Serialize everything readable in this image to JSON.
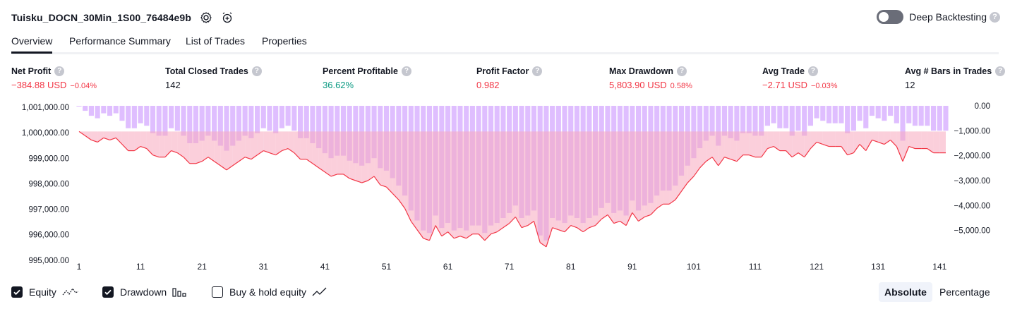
{
  "header": {
    "strategy_name": "Tuisku_DOCN_30Min_1S00_76484e9b",
    "deep_backtesting_label": "Deep Backtesting",
    "help_glyph": "?"
  },
  "tabs": [
    "Overview",
    "Performance Summary",
    "List of Trades",
    "Properties"
  ],
  "metrics": [
    {
      "label": "Net Profit",
      "value": "−384.88 USD",
      "pct": "−0.04%",
      "color": "red"
    },
    {
      "label": "Total Closed Trades",
      "value": "142",
      "pct": "",
      "color": "dark"
    },
    {
      "label": "Percent Profitable",
      "value": "36.62%",
      "pct": "",
      "color": "green"
    },
    {
      "label": "Profit Factor",
      "value": "0.982",
      "pct": "",
      "color": "red"
    },
    {
      "label": "Max Drawdown",
      "value": "5,803.90 USD",
      "pct": "0.58%",
      "color": "red"
    },
    {
      "label": "Avg Trade",
      "value": "−2.71 USD",
      "pct": "−0.03%",
      "color": "red"
    },
    {
      "label": "Avg # Bars in Trades",
      "value": "12",
      "pct": "",
      "color": "dark"
    }
  ],
  "legend": {
    "equity": "Equity",
    "drawdown": "Drawdown",
    "buy_hold": "Buy & hold equity",
    "equity_checked": true,
    "drawdown_checked": true,
    "buy_hold_checked": false
  },
  "view_modes": {
    "absolute": "Absolute",
    "percentage": "Percentage",
    "selected": "Absolute"
  },
  "colors": {
    "equity_loss": "#f23645",
    "equity_gain": "#22ab94",
    "drawdown_bar": "#d9b3ff",
    "loss_fill": "#f7a8be",
    "gain_fill": "#c9ede3",
    "text": "#131722"
  },
  "chart_data": {
    "type": "line",
    "x": [
      1,
      2,
      3,
      4,
      5,
      6,
      7,
      8,
      9,
      10,
      11,
      12,
      13,
      14,
      15,
      16,
      17,
      18,
      19,
      20,
      21,
      22,
      23,
      24,
      25,
      26,
      27,
      28,
      29,
      30,
      31,
      32,
      33,
      34,
      35,
      36,
      37,
      38,
      39,
      40,
      41,
      42,
      43,
      44,
      45,
      46,
      47,
      48,
      49,
      50,
      51,
      52,
      53,
      54,
      55,
      56,
      57,
      58,
      59,
      60,
      61,
      62,
      63,
      64,
      65,
      66,
      67,
      68,
      69,
      70,
      71,
      72,
      73,
      74,
      75,
      76,
      77,
      78,
      79,
      80,
      81,
      82,
      83,
      84,
      85,
      86,
      87,
      88,
      89,
      90,
      91,
      92,
      93,
      94,
      95,
      96,
      97,
      98,
      99,
      100,
      101,
      102,
      103,
      104,
      105,
      106,
      107,
      108,
      109,
      110,
      111,
      112,
      113,
      114,
      115,
      116,
      117,
      118,
      119,
      120,
      121,
      122,
      123,
      124,
      125,
      126,
      127,
      128,
      129,
      130,
      131,
      132,
      133,
      134,
      135,
      136,
      137,
      138,
      139,
      140,
      141,
      142
    ],
    "x_ticks": [
      1,
      11,
      21,
      31,
      41,
      51,
      61,
      71,
      81,
      91,
      101,
      111,
      121,
      131,
      141
    ],
    "series": [
      {
        "name": "Equity",
        "axis": "left",
        "values": [
          1000000,
          999800,
          999600,
          999500,
          999700,
          999600,
          999700,
          999400,
          999100,
          999100,
          999300,
          999200,
          998900,
          998800,
          998800,
          999100,
          999000,
          998800,
          998500,
          998500,
          998600,
          998800,
          998600,
          998400,
          998200,
          998400,
          998600,
          998800,
          998700,
          998900,
          999100,
          999000,
          998900,
          999100,
          999200,
          999000,
          998700,
          998700,
          998500,
          998300,
          998100,
          997900,
          998000,
          998000,
          997800,
          997700,
          997600,
          997700,
          997900,
          997500,
          997400,
          997100,
          996800,
          996400,
          995800,
          995400,
          995000,
          994900,
          995600,
          995100,
          995300,
          995000,
          995100,
          995000,
          995200,
          995200,
          994900,
          995200,
          995300,
          995500,
          995700,
          996000,
          995500,
          995600,
          995800,
          994800,
          994600,
          995500,
          995400,
          995300,
          995600,
          995500,
          995300,
          995500,
          995600,
          995900,
          996100,
          995700,
          995800,
          995600,
          996200,
          995800,
          996000,
          996100,
          996400,
          996600,
          996600,
          996800,
          997200,
          997600,
          997900,
          998300,
          998600,
          998800,
          998400,
          998800,
          998700,
          998600,
          998900,
          998900,
          998800,
          998800,
          999200,
          999300,
          999100,
          999100,
          998800,
          999000,
          998800,
          999200,
          999500,
          999400,
          999300,
          999300,
          999300,
          998900,
          999000,
          999400,
          999100,
          999600,
          999500,
          999400,
          999600,
          999300,
          998600,
          999300,
          999200,
          999200,
          999200,
          999000,
          999000,
          999000
        ],
        "color": "#f23645"
      },
      {
        "name": "Drawdown",
        "axis": "right",
        "values": [
          0,
          -200,
          -400,
          -500,
          -300,
          -400,
          -300,
          -600,
          -900,
          -900,
          -700,
          -800,
          -1100,
          -1200,
          -1200,
          -900,
          -1000,
          -1200,
          -1500,
          -1500,
          -1400,
          -1200,
          -1400,
          -1600,
          -1800,
          -1600,
          -1400,
          -1200,
          -1300,
          -1100,
          -900,
          -1000,
          -1100,
          -900,
          -800,
          -1000,
          -1300,
          -1300,
          -1500,
          -1700,
          -1900,
          -2100,
          -2000,
          -2000,
          -2200,
          -2300,
          -2400,
          -2300,
          -2100,
          -2500,
          -2600,
          -2900,
          -3200,
          -3600,
          -4200,
          -4600,
          -5000,
          -5100,
          -4400,
          -4900,
          -4700,
          -5000,
          -4900,
          -5000,
          -4800,
          -4800,
          -5100,
          -4800,
          -4700,
          -4500,
          -4300,
          -4000,
          -4500,
          -4400,
          -4200,
          -5200,
          -5400,
          -4500,
          -4600,
          -4700,
          -4400,
          -4500,
          -4700,
          -4500,
          -4400,
          -4100,
          -3900,
          -4300,
          -4200,
          -4400,
          -3800,
          -4200,
          -4000,
          -3900,
          -3600,
          -3400,
          -3400,
          -3200,
          -2800,
          -2400,
          -2100,
          -1700,
          -1400,
          -1200,
          -1600,
          -1200,
          -1300,
          -1400,
          -1100,
          -1100,
          -1200,
          -1200,
          -800,
          -700,
          -900,
          -900,
          -1200,
          -1000,
          -1200,
          -800,
          -500,
          -600,
          -700,
          -700,
          -700,
          -1100,
          -1000,
          -600,
          -900,
          -400,
          -500,
          -600,
          -400,
          -700,
          -1400,
          -700,
          -800,
          -800,
          -800,
          -1000,
          -1000,
          -1000
        ],
        "color": "#d9b3ff"
      }
    ],
    "y_left": {
      "ticks": [
        "1,001,000.00",
        "1,000,000.00",
        "999,000.00",
        "998,000.00",
        "997,000.00",
        "996,000.00",
        "995,000.00"
      ],
      "range": [
        994200,
        1001200
      ]
    },
    "y_right": {
      "ticks": [
        "0.00",
        "−1,000.00",
        "−2,000.00",
        "−3,000.00",
        "−4,000.00",
        "−5,000.00"
      ],
      "range": [
        -6000,
        0
      ]
    }
  }
}
